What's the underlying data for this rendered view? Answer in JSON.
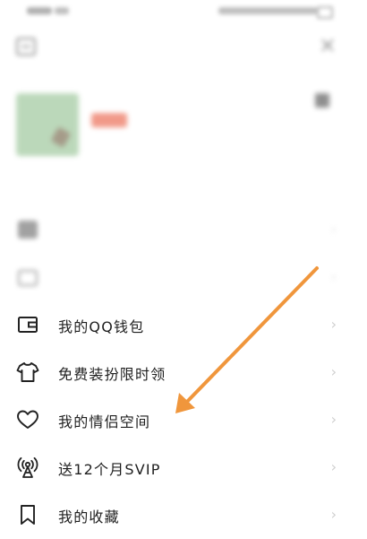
{
  "status_bar": {
    "icon": "status-bar-icons"
  },
  "top_bar": {
    "title": "",
    "close_icon": "×",
    "scan_icon": "scan-icon"
  },
  "profile": {
    "nickname": "",
    "vip_text": "",
    "signature": "",
    "avatar_icon": "avatar-image"
  },
  "menu": [
    {
      "label": "",
      "icon": "vip-icon"
    },
    {
      "label": "",
      "icon": "gift-icon"
    },
    {
      "label": "我的QQ钱包",
      "icon": "wallet-icon"
    },
    {
      "label": "免费装扮限时领",
      "icon": "tshirt-icon"
    },
    {
      "label": "我的情侣空间",
      "icon": "heart-icon"
    },
    {
      "label": "送12个月SVIP",
      "icon": "broadcast-icon"
    },
    {
      "label": "我的收藏",
      "icon": "bookmark-icon"
    }
  ],
  "chevron": "›",
  "annotation": {
    "color": "#f0963c",
    "icon": "orange-pointer-arrow"
  }
}
